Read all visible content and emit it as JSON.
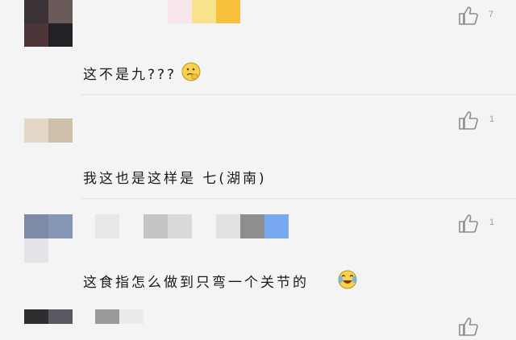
{
  "comments": [
    {
      "text": "这不是九???",
      "likes": "7",
      "emoji": "thinking-face-emoji"
    },
    {
      "text": "我这也是这样是 七(湖南)",
      "likes": "1"
    },
    {
      "text": "这食指怎么做到只弯一个关节的",
      "likes": "1",
      "emoji": "laughing-crying-emoji"
    },
    {
      "text": "",
      "likes": ""
    }
  ],
  "colors": {
    "background": "#f4f4f4",
    "divider": "#e3e3e3",
    "like_icon": "#8c8c8c",
    "text": "#1a1a1a"
  },
  "icons": [
    "thumbs-up-icon",
    "thinking-face-emoji",
    "laughing-crying-emoji"
  ]
}
